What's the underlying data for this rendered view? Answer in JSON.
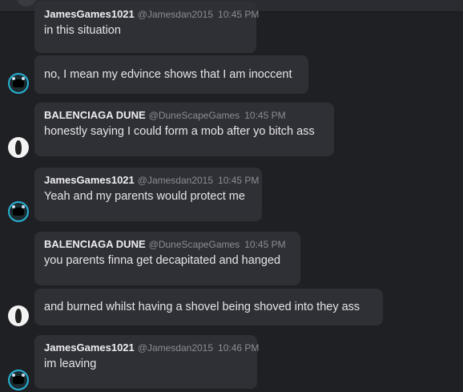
{
  "messages": [
    {
      "author": "JamesGames1021",
      "handle": "@Jamesdan2015",
      "time": "10:45 PM",
      "text": "in this situation"
    },
    {
      "author": "",
      "handle": "",
      "time": "",
      "text": "no, I mean my edvince shows that I am inoccent"
    },
    {
      "author": "BALENCIAGA DUNE",
      "handle": "@DuneScapeGames",
      "time": "10:45 PM",
      "text": "honestly saying I could form a mob after yo bitch ass"
    },
    {
      "author": "JamesGames1021",
      "handle": "@Jamesdan2015",
      "time": "10:45 PM",
      "text": "Yeah and my parents would protect me"
    },
    {
      "author": "BALENCIAGA DUNE",
      "handle": "@DuneScapeGames",
      "time": "10:45 PM",
      "text": "you parents finna get decapitated and hanged"
    },
    {
      "author": "",
      "handle": "",
      "time": "",
      "text": "and burned whilst having a shovel being shoved into they ass"
    },
    {
      "author": "JamesGames1021",
      "handle": "@Jamesdan2015",
      "time": "10:46 PM",
      "text": "im leaving"
    }
  ],
  "avatars": {
    "james": "gamer-avatar-icon",
    "balenciaga": "dark-figure-avatar-icon"
  },
  "colors": {
    "background": "#1f2024",
    "bubble": "#2f3036",
    "meta": "#8b8d94",
    "avatar_ring": "#27b3d4"
  }
}
